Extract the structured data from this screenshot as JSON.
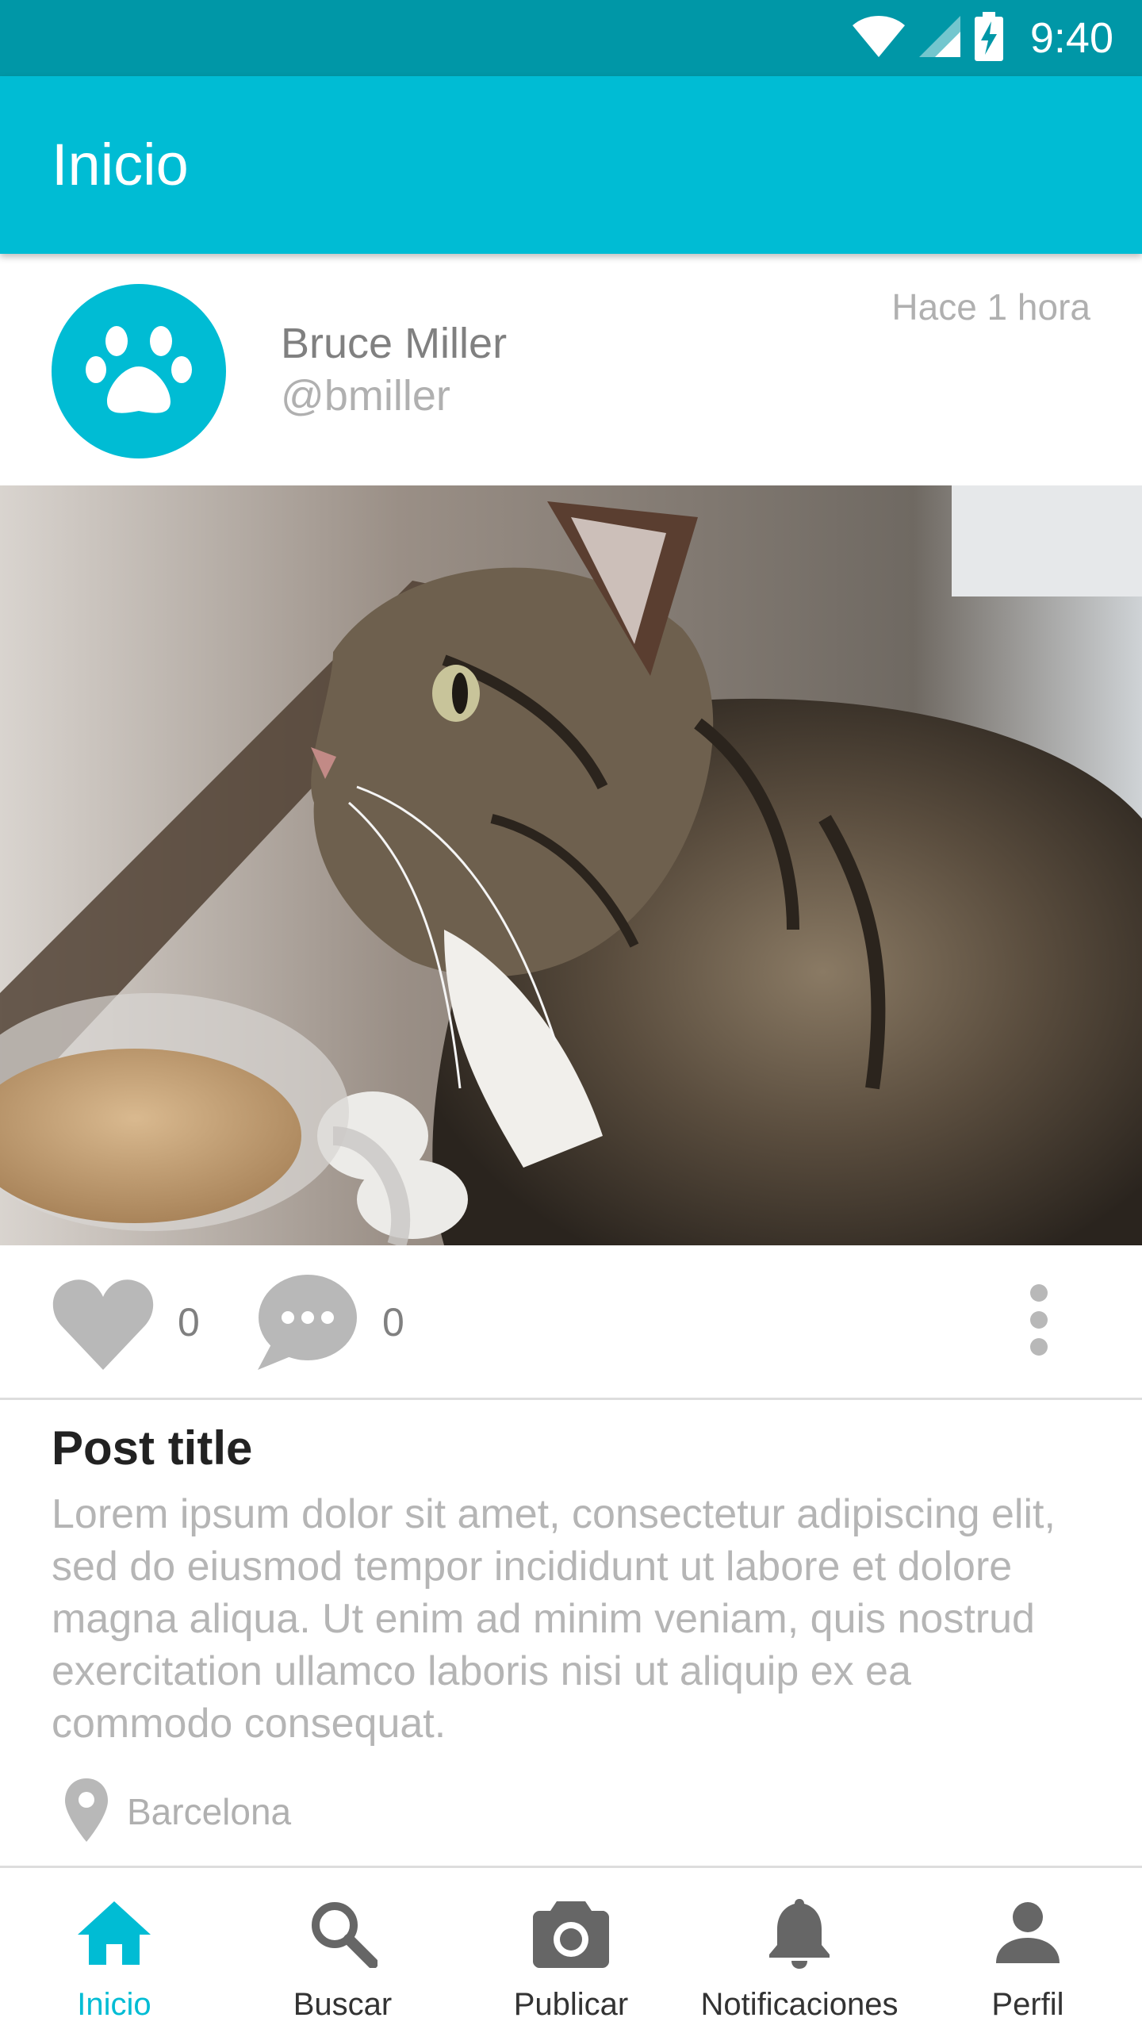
{
  "colors": {
    "status_bar": "#0097a7",
    "primary": "#00bcd4",
    "icon_gray": "#b8b8b8",
    "nav_icon_gray": "#666666",
    "text_muted": "#b0b0b0"
  },
  "status_bar": {
    "time": "9:40",
    "icons": [
      "wifi-icon",
      "signal-icon",
      "battery-charging-icon"
    ]
  },
  "app_bar": {
    "title": "Inicio"
  },
  "post": {
    "avatar_icon": "paw-icon",
    "author_name": "Bruce Miller",
    "author_handle": "@bmiller",
    "time_ago": "Hace 1 hora",
    "image": "tabby kitten photo",
    "likes": "0",
    "comments": "0",
    "title": "Post title",
    "body": "Lorem ipsum dolor sit amet, consectetur adipiscing elit, sed do eiusmod tempor incididunt ut labore et dolore magna aliqua. Ut enim ad minim veniam, quis nostrud exercitation ullamco laboris nisi ut aliquip ex ea commodo consequat.",
    "location": "Barcelona"
  },
  "bottom_nav": {
    "items": [
      {
        "label": "Inicio",
        "icon": "home-icon",
        "active": true
      },
      {
        "label": "Buscar",
        "icon": "search-icon",
        "active": false
      },
      {
        "label": "Publicar",
        "icon": "camera-icon",
        "active": false
      },
      {
        "label": "Notificaciones",
        "icon": "bell-icon",
        "active": false
      },
      {
        "label": "Perfil",
        "icon": "person-icon",
        "active": false
      }
    ]
  }
}
